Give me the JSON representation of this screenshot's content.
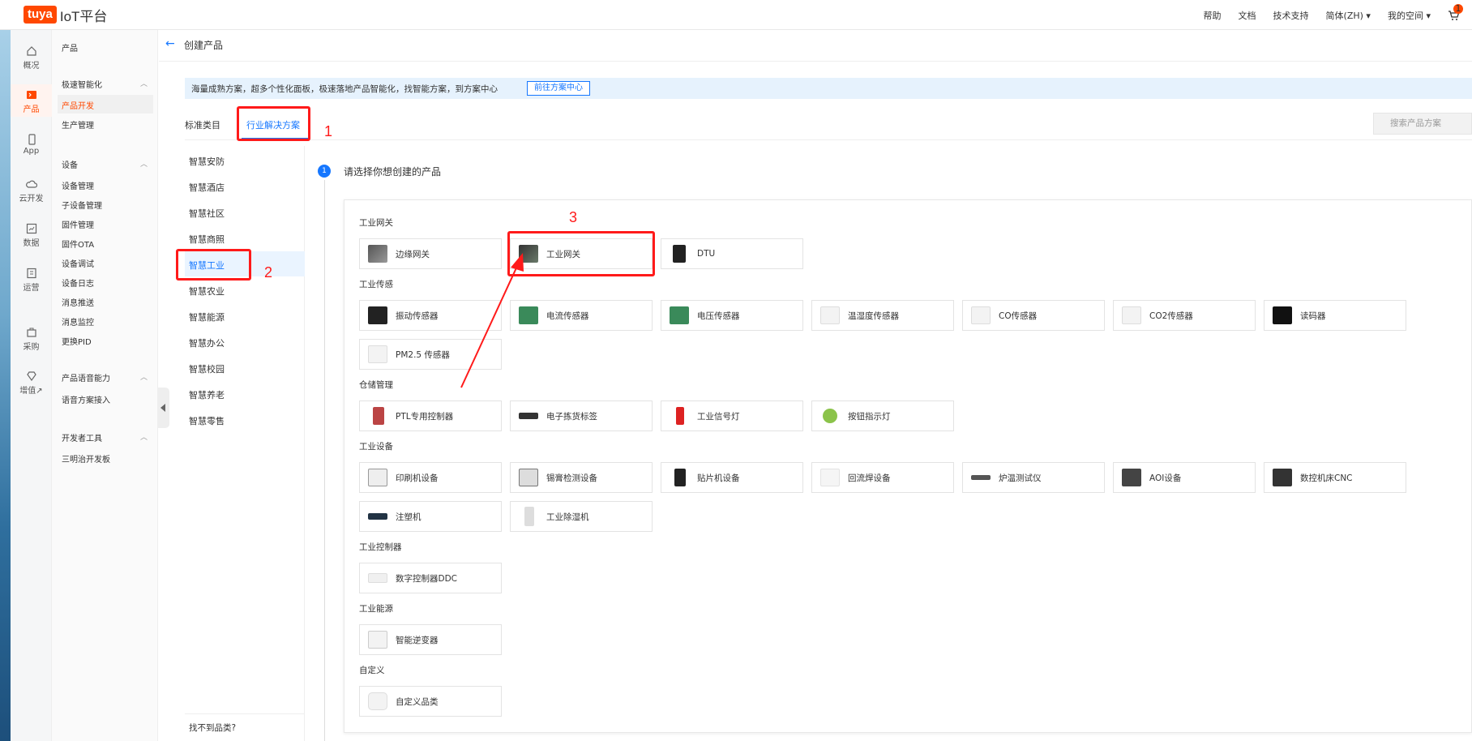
{
  "topbar": {
    "logo_brand": "tuya",
    "logo_text": "IoT平台",
    "nav": [
      "帮助",
      "文档",
      "技术支持",
      "简体(ZH) ▾",
      "我的空间 ▾"
    ],
    "cart_badge": "1"
  },
  "rail": [
    {
      "label": "概况",
      "icon": "home-icon"
    },
    {
      "label": "产品",
      "icon": "product-icon",
      "active": true
    },
    {
      "label": "App",
      "icon": "phone-icon"
    },
    {
      "label": "云开发",
      "icon": "cloud-icon"
    },
    {
      "label": "数据",
      "icon": "chart-icon"
    },
    {
      "label": "运营",
      "icon": "operate-icon"
    },
    {
      "label": "采购",
      "icon": "purchase-icon"
    },
    {
      "label": "增值↗",
      "icon": "diamond-icon"
    }
  ],
  "sidebar": {
    "title": "产品",
    "groups": [
      {
        "label": "极速智能化",
        "items": [
          "产品开发",
          "生产管理"
        ]
      },
      {
        "label": "设备",
        "items": [
          "设备管理",
          "子设备管理",
          "固件管理",
          "固件OTA",
          "设备调试",
          "设备日志",
          "消息推送",
          "消息监控",
          "更换PID"
        ]
      },
      {
        "label": "产品语音能力",
        "items": [
          "语音方案接入"
        ]
      },
      {
        "label": "开发者工具",
        "items": [
          "三明治开发板"
        ]
      }
    ]
  },
  "header": {
    "crumb": "创建产品"
  },
  "banner": {
    "text": "海量成熟方案，超多个性化面板，极速落地产品智能化，找智能方案，到方案中心",
    "button": "前往方案中心"
  },
  "tabs": {
    "standard": "标准类目",
    "industry": "行业解决方案",
    "search": "搜索产品方案"
  },
  "annotations": {
    "a1": "1",
    "a2": "2",
    "a3": "3"
  },
  "categories": [
    "智慧安防",
    "智慧酒店",
    "智慧社区",
    "智慧商照",
    "智慧工业",
    "智慧农业",
    "智慧能源",
    "智慧办公",
    "智慧校园",
    "智慧养老",
    "智慧零售"
  ],
  "cant_find": "找不到品类?",
  "step": {
    "num": "1",
    "label": "请选择你想创建的产品"
  },
  "sections": [
    {
      "title": "工业网关",
      "items": [
        "边缘网关",
        "工业网关",
        "DTU"
      ]
    },
    {
      "title": "工业传感",
      "items": [
        "振动传感器",
        "电流传感器",
        "电压传感器",
        "温湿度传感器",
        "CO传感器",
        "CO2传感器",
        "读码器",
        "PM2.5 传感器"
      ]
    },
    {
      "title": "仓储管理",
      "items": [
        "PTL专用控制器",
        "电子拣货标签",
        "工业信号灯",
        "按钮指示灯"
      ]
    },
    {
      "title": "工业设备",
      "items": [
        "印刷机设备",
        "锡膏检测设备",
        "贴片机设备",
        "回流焊设备",
        "炉温测试仪",
        "AOI设备",
        "数控机床CNC",
        "注塑机",
        "工业除湿机"
      ]
    },
    {
      "title": "工业控制器",
      "items": [
        "数字控制器DDC"
      ]
    },
    {
      "title": "工业能源",
      "items": [
        "智能逆变器"
      ]
    },
    {
      "title": "自定义",
      "items": [
        "自定义品类"
      ]
    }
  ],
  "colors": {
    "brand": "#ff4800",
    "accent": "#1677ff",
    "highlight": "#ff1a1a"
  }
}
